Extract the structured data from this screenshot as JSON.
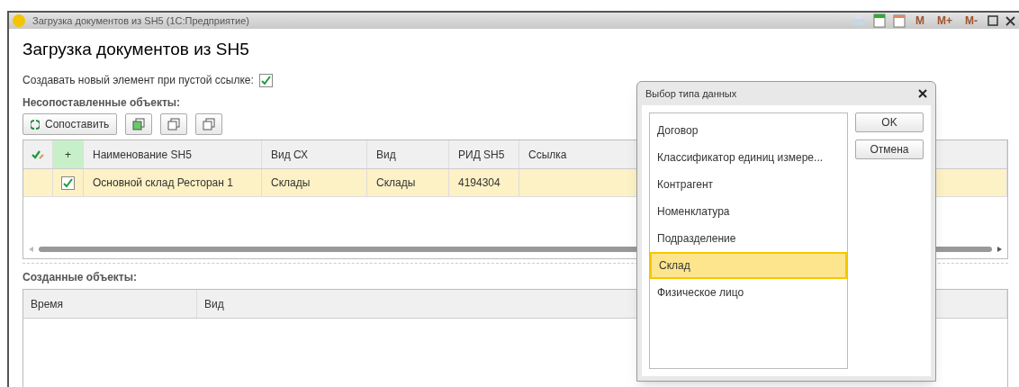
{
  "window": {
    "title": "Загрузка документов из SH5  (1С:Предприятие)",
    "toolbar": [
      "M",
      "M+",
      "M-"
    ]
  },
  "heading": "Загрузка документов из SH5",
  "create_option": {
    "label": "Создавать новый элемент при пустой ссылке:",
    "checked": true
  },
  "unmatched": {
    "title": "Несопоставленные объекты:",
    "match_button": "Сопоставить",
    "columns": [
      "+",
      "Наименование SH5",
      "Вид СХ",
      "Вид",
      "РИД SH5",
      "Ссылка"
    ],
    "rows": [
      {
        "selected": true,
        "checked": true,
        "cells": [
          "",
          "Основной склад Ресторан 1",
          "Склады",
          "Склады",
          "4194304",
          ""
        ]
      }
    ]
  },
  "created": {
    "title": "Созданные объекты:",
    "columns": [
      "Время",
      "Вид"
    ]
  },
  "dialog": {
    "title": "Выбор типа данных",
    "buttons": [
      "OK",
      "Отмена"
    ],
    "items": [
      {
        "label": "Договор",
        "selected": false
      },
      {
        "label": "Классификатор единиц измере...",
        "selected": false
      },
      {
        "label": "Контрагент",
        "selected": false
      },
      {
        "label": "Номенклатура",
        "selected": false
      },
      {
        "label": "Подразделение",
        "selected": false
      },
      {
        "label": "Склад",
        "selected": true
      },
      {
        "label": "Физическое лицо",
        "selected": false
      }
    ]
  }
}
